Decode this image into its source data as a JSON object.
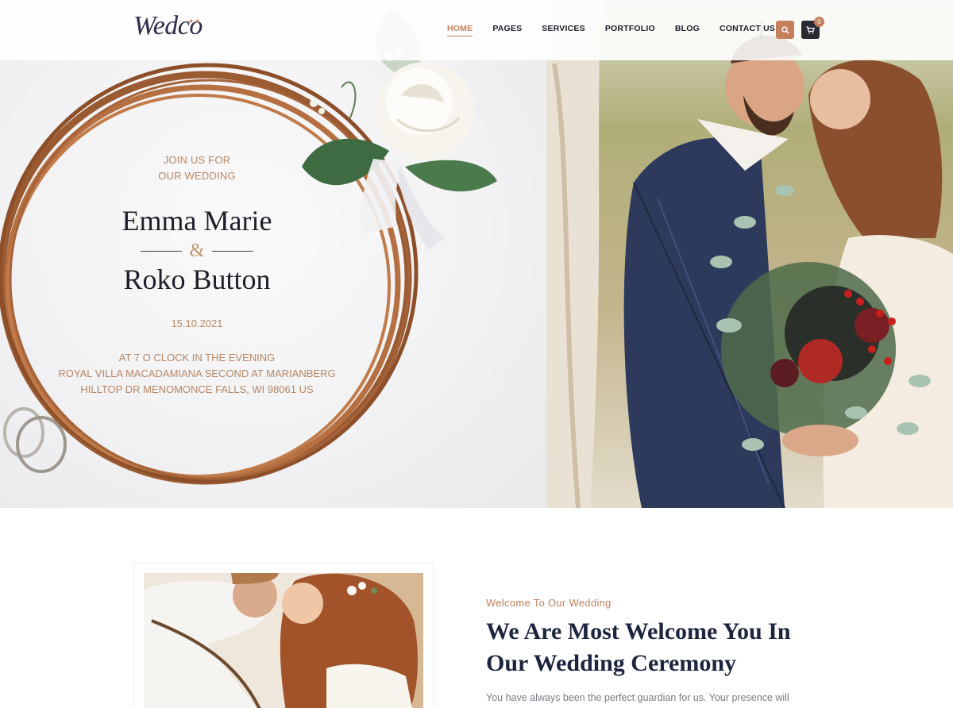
{
  "brand": {
    "logo_text": "Wedco",
    "logo_stars": "★★"
  },
  "nav": {
    "items": [
      {
        "label": "HOME",
        "active": true
      },
      {
        "label": "PAGES",
        "active": false
      },
      {
        "label": "SERVICES",
        "active": false
      },
      {
        "label": "PORTFOLIO",
        "active": false
      },
      {
        "label": "BLOG",
        "active": false
      },
      {
        "label": "CONTACT US",
        "active": false
      }
    ],
    "search_icon": "search-icon",
    "cart_icon": "cart-icon",
    "cart_count": "0"
  },
  "hero": {
    "intro": "JOIN US FOR OUR WEDDING",
    "name_1": "Emma Marie",
    "ampersand": "&",
    "name_2": "Roko Button",
    "date": "15.10.2021",
    "venue_1": "AT 7 O CLOCK IN THE EVENING",
    "venue_2": "ROYAL VILLA MACADAMIANA SECOND AT MARIANBERG",
    "venue_3": "HILLTOP DR MENOMONCE FALLS, WI 98061 US"
  },
  "welcome": {
    "kicker": "Welcome To Our Wedding",
    "title": "We Are Most Welcome You In Our Wedding Ceremony",
    "body": "You have always been the perfect guardian for us. Your presence will more than expected during this holy occasion of our lives. Bless our holy union with presence"
  },
  "colors": {
    "accent": "#c4805a",
    "navy": "#1c2440",
    "dark_button": "#2a2a33"
  }
}
